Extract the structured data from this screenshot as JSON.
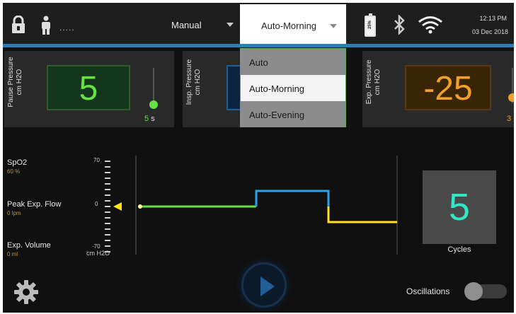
{
  "header": {
    "patient_id": ".....",
    "mode_label": "Manual",
    "submode_selected": "Auto-Morning",
    "battery_percent": "25%",
    "time": "12:13 PM",
    "date": "03 Dec 2018",
    "icons": [
      "lock-icon",
      "person-icon",
      "battery-icon",
      "bluetooth-icon",
      "wifi-icon"
    ]
  },
  "dropdown": {
    "options": [
      "Auto",
      "Auto-Morning",
      "Auto-Evening"
    ],
    "selected_index": 1
  },
  "pressures": {
    "pause": {
      "label": "Pause Pressure",
      "unit": "cm H2O",
      "value": "5",
      "time": "5",
      "time_unit": "s"
    },
    "insp": {
      "label": "Insp. Pressure",
      "unit": "cm H2O"
    },
    "exp": {
      "label": "Exp. Pressure",
      "unit": "cm H2O",
      "value": "-25",
      "time": "3",
      "time_unit": "s"
    }
  },
  "metrics": [
    {
      "label": "SpO2",
      "value": "60 %"
    },
    {
      "label": "Peak Exp. Flow",
      "value": "0 lpm"
    },
    {
      "label": "Exp. Volume",
      "value": "0 ml"
    }
  ],
  "scale": {
    "max": "70",
    "zero": "0",
    "min": "-70",
    "unit": "cm H2O"
  },
  "waveform": {
    "x": [
      0,
      1,
      2,
      3,
      4,
      5
    ],
    "pause_level": 0,
    "insp_level": 20,
    "exp_level": -20
  },
  "cycles": {
    "value": "5",
    "label": "Cycles"
  },
  "oscillations": {
    "label": "Oscillations",
    "enabled": false
  },
  "colors": {
    "accent_blue": "#2b7fb8",
    "pause_green": "#66e142",
    "insp_blue": "#2aa3e8",
    "exp_orange": "#f0a028",
    "exp_yellow": "#ffe11e",
    "cycles_teal": "#33e6c4"
  }
}
